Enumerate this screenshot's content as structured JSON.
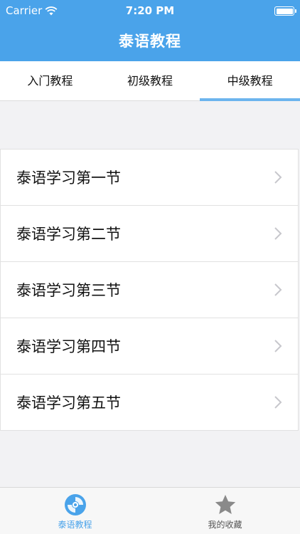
{
  "status_bar": {
    "carrier": "Carrier",
    "time": "7:20 PM"
  },
  "nav": {
    "title": "泰语教程"
  },
  "tabs": [
    {
      "label": "入门教程"
    },
    {
      "label": "初级教程"
    },
    {
      "label": "中级教程"
    }
  ],
  "lessons": [
    {
      "label": "泰语学习第一节"
    },
    {
      "label": "泰语学习第二节"
    },
    {
      "label": "泰语学习第三节"
    },
    {
      "label": "泰语学习第四节"
    },
    {
      "label": "泰语学习第五节"
    }
  ],
  "tabbar": [
    {
      "label": "泰语教程",
      "icon": "disc-icon"
    },
    {
      "label": "我的收藏",
      "icon": "star-icon"
    }
  ],
  "colors": {
    "accent": "#4aa3ea",
    "tab_indicator": "#6cb5ee",
    "inactive_icon": "#8a8a8a"
  }
}
